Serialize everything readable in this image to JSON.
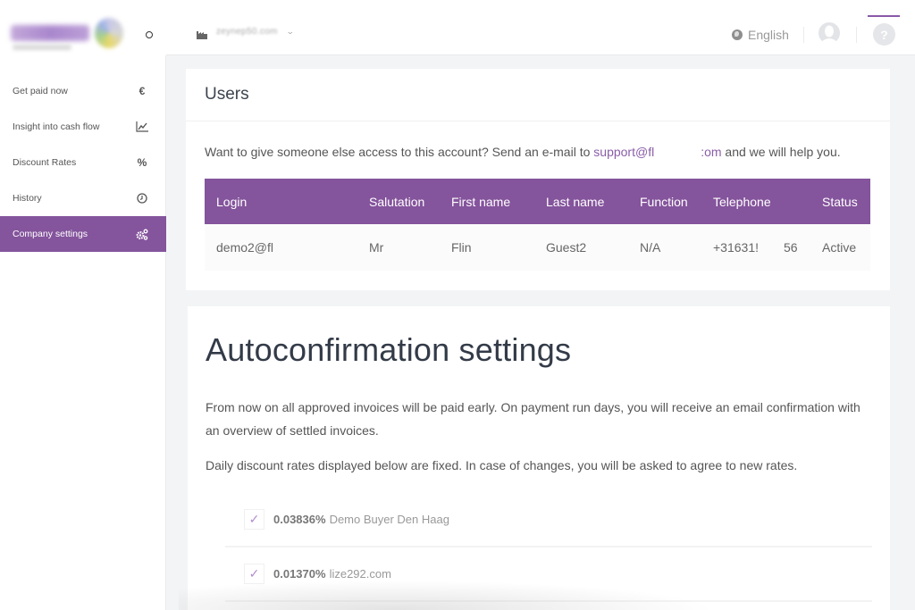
{
  "sidebar": {
    "brand": "Flinder",
    "items": [
      {
        "label": "Get paid now",
        "icon": "euro-icon",
        "glyph": "€",
        "active": false
      },
      {
        "label": "Insight into cash flow",
        "icon": "line-chart-icon",
        "glyph": "",
        "active": false
      },
      {
        "label": "Discount Rates",
        "icon": "percent-icon",
        "glyph": "%",
        "active": false
      },
      {
        "label": "History",
        "icon": "clock-icon",
        "glyph": "",
        "active": false
      },
      {
        "label": "Company settings",
        "icon": "gears-icon",
        "glyph": "",
        "active": true
      }
    ]
  },
  "topbar": {
    "company": "zeynep50.com",
    "language": "English",
    "help_glyph": "?"
  },
  "users": {
    "title": "Users",
    "intro_before": "Want to give someone else access to this account? Send an e-mail to ",
    "intro_link_start": "support@fl",
    "intro_link_end": ":om",
    "intro_after": " and we will help you.",
    "columns": [
      "Login",
      "Salutation",
      "First name",
      "Last name",
      "Function",
      "Telephone",
      "Status"
    ],
    "rows": [
      {
        "login": "demo2@fl",
        "salutation": "Mr",
        "first_name": "Flin",
        "last_name": "Guest2",
        "function": "N/A",
        "telephone": "+31631!",
        "telephone_end": "56",
        "status": "Active"
      }
    ]
  },
  "autoconfirmation": {
    "title": "Autoconfirmation settings",
    "paragraph1": "From now on all approved invoices will be paid early. On payment run days, you will receive an email confirmation with an overview of settled invoices.",
    "paragraph2": "Daily discount rates displayed below are fixed. In case of changes, you will be asked to agree to new rates.",
    "rates": [
      {
        "checked": true,
        "rate": "0.03836%",
        "buyer": "Demo Buyer Den Haag"
      },
      {
        "checked": true,
        "rate": "0.01370%",
        "buyer": "lize292.com"
      }
    ]
  },
  "colors": {
    "accent": "#84549c",
    "link": "#8a5ea7",
    "background": "#f3f4f6"
  }
}
